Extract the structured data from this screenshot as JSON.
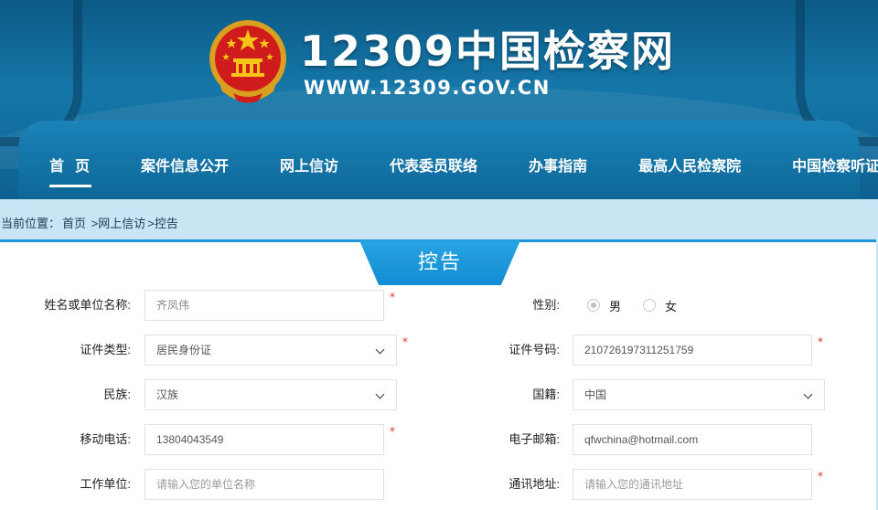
{
  "site": {
    "logo_text": "12309中国检察网",
    "url_text": "WWW.12309.GOV.CN"
  },
  "nav": {
    "items": [
      {
        "label": "首页",
        "active": true
      },
      {
        "label": "案件信息公开"
      },
      {
        "label": "网上信访"
      },
      {
        "label": "代表委员联络"
      },
      {
        "label": "办事指南"
      },
      {
        "label": "最高人民检察院"
      },
      {
        "label": "中国检察听证网"
      }
    ]
  },
  "breadcrumb": {
    "prefix": "当前位置：",
    "items": [
      "首页",
      ">网上信访",
      ">控告"
    ]
  },
  "form": {
    "title": "控告",
    "required_mark": "*",
    "name": {
      "label": "姓名或单位名称:",
      "value": "齐凤伟"
    },
    "gender": {
      "label": "性别:",
      "options": [
        "男",
        "女"
      ],
      "selected": "男"
    },
    "id_type": {
      "label": "证件类型:",
      "value": "居民身份证"
    },
    "id_number": {
      "label": "证件号码:",
      "value": "210726197311251759"
    },
    "ethnicity": {
      "label": "民族:",
      "value": "汉族"
    },
    "nationality": {
      "label": "国籍:",
      "value": "中国"
    },
    "mobile": {
      "label": "移动电话:",
      "value": "13804043549"
    },
    "email": {
      "label": "电子邮箱:",
      "value": "qfwchina@hotmail.com"
    },
    "employer": {
      "label": "工作单位:",
      "placeholder": "请输入您的单位名称"
    },
    "address": {
      "label": "通讯地址:",
      "placeholder": "请输入您的通讯地址"
    }
  },
  "colors": {
    "header_dark": "#0c5a86",
    "nav_blue": "#1b83b8",
    "accent": "#1b95d6",
    "required": "#e03030"
  }
}
